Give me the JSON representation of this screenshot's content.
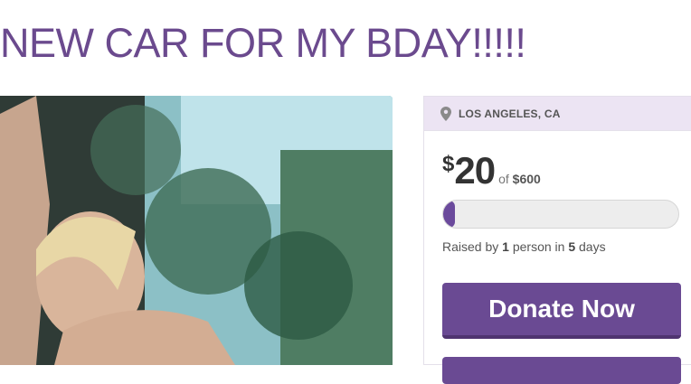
{
  "campaign": {
    "title": "NEW CAR FOR MY BDAY!!!!!"
  },
  "sidebar": {
    "location": "LOS ANGELES, CA",
    "location_icon": "map-pin-icon",
    "amount_currency": "$",
    "amount_raised": "20",
    "goal_prefix": "of",
    "goal_amount": "$600",
    "progress_fraction": 0.033,
    "raised_prefix": "Raised by",
    "raised_count": "1",
    "raised_unit": "person in",
    "raised_days": "5",
    "raised_suffix": "days",
    "donate_label": "Donate Now",
    "accent_color": "#6a4a93",
    "title_color": "#6b4a8e"
  }
}
